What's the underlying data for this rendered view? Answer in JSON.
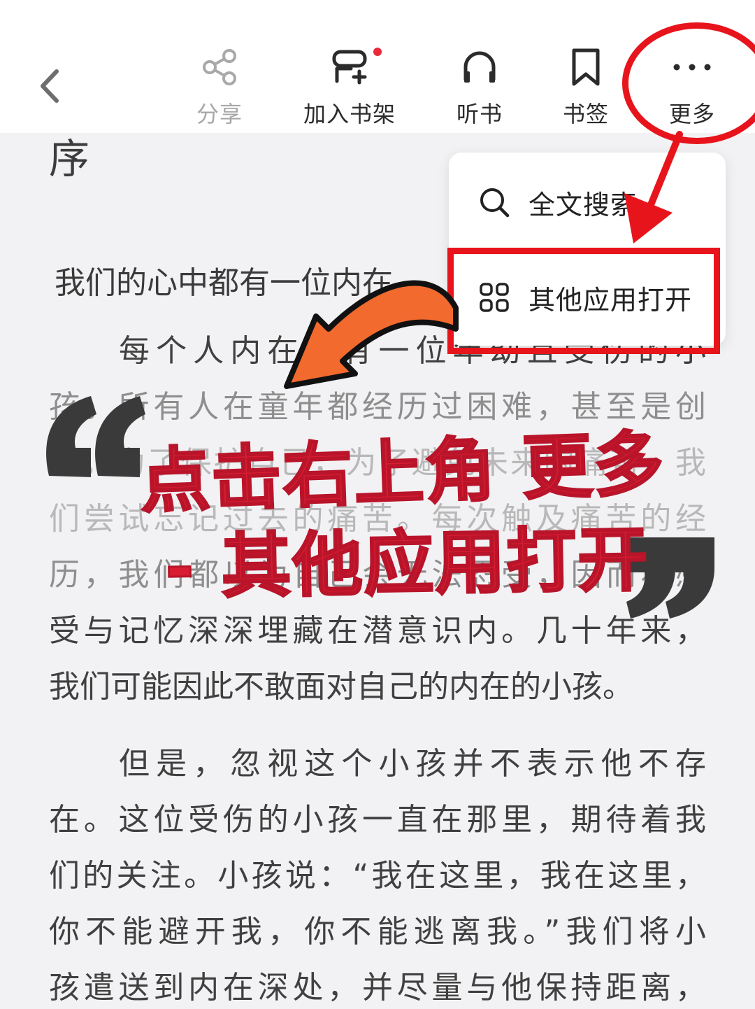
{
  "toolbar": {
    "back_icon": "chevron-left-icon",
    "items": [
      {
        "label": "分享",
        "icon": "share-icon",
        "enabled": false
      },
      {
        "label": "加入书架",
        "icon": "bookshelf-add-icon",
        "has_badge": true
      },
      {
        "label": "听书",
        "icon": "headphones-icon"
      },
      {
        "label": "书签",
        "icon": "bookmark-icon"
      },
      {
        "label": "更多",
        "icon": "more-dots-icon"
      }
    ]
  },
  "menu": {
    "items": [
      {
        "label": "全文搜索",
        "icon": "search-icon"
      },
      {
        "label": "其他应用打开",
        "icon": "apps-grid-icon"
      }
    ]
  },
  "content": {
    "chapter_title": "序",
    "para_head": "我们的心中都有一位内在",
    "lines": [
      "每个人内在都有一位年幼且受伤的小",
      "孩。所有人在童年都经历过困难，甚至是创",
      "伤。为了保护自己，为了避免未来的痛苦，我",
      "们尝试忘记过去的痛苦。每次触及痛苦的经",
      "历，我们都以为自己会无法忍受，因而将感",
      "受与记忆深深埋藏在潜意识内。几十年来，",
      "我们可能因此不敢面对自己的内在的小孩。",
      "但是，忽视这个小孩并不表示他不存",
      "在。这位受伤的小孩一直在那里，期待着我",
      "们的关注。小孩说：“我在这里，我在这里，",
      "你不能避开我，你不能逃离我。”我们将小",
      "孩遣送到内在深处，并尽量与他保持距离，"
    ]
  },
  "annotation": {
    "line1": "点击右上角 更多",
    "line2": "- 其他应用打开",
    "accent_color": "#d81d32",
    "arrow_color": "#f26a2e",
    "highlight_color": "#e8141c"
  }
}
